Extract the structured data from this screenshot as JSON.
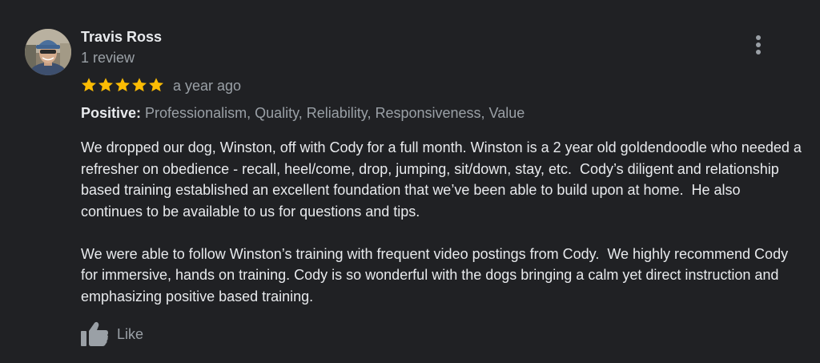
{
  "review": {
    "author_name": "Travis Ross",
    "review_count": "1 review",
    "rating": 5,
    "rating_max": 5,
    "date": "a year ago",
    "attributes_label": "Positive:",
    "attributes_values": " Professionalism, Quality, Reliability, Responsiveness, Value",
    "paragraphs": [
      "We dropped our dog, Winston, off with Cody for a full month. Winston is a 2 year old goldendoodle who needed a refresher on obedience - recall, heel/come, drop, jumping, sit/down, stay, etc.  Cody’s diligent and relationship based training established an excellent foundation that we’ve been able to build upon at home.  He also continues to be available to us for questions and tips.",
      "We were able to follow Winston’s training with frequent video postings from Cody.  We highly recommend Cody for immersive, hands on training. Cody is so wonderful with the dogs bringing a calm yet direct instruction and emphasizing positive based training."
    ],
    "like_label": "Like"
  },
  "icons": {
    "menu": "more-vert-icon",
    "star": "star-icon",
    "like": "thumb-up-icon"
  },
  "colors": {
    "background": "#202124",
    "primary_text": "#e8eaed",
    "secondary_text": "#9aa0a6",
    "star": "#fbbc04"
  }
}
